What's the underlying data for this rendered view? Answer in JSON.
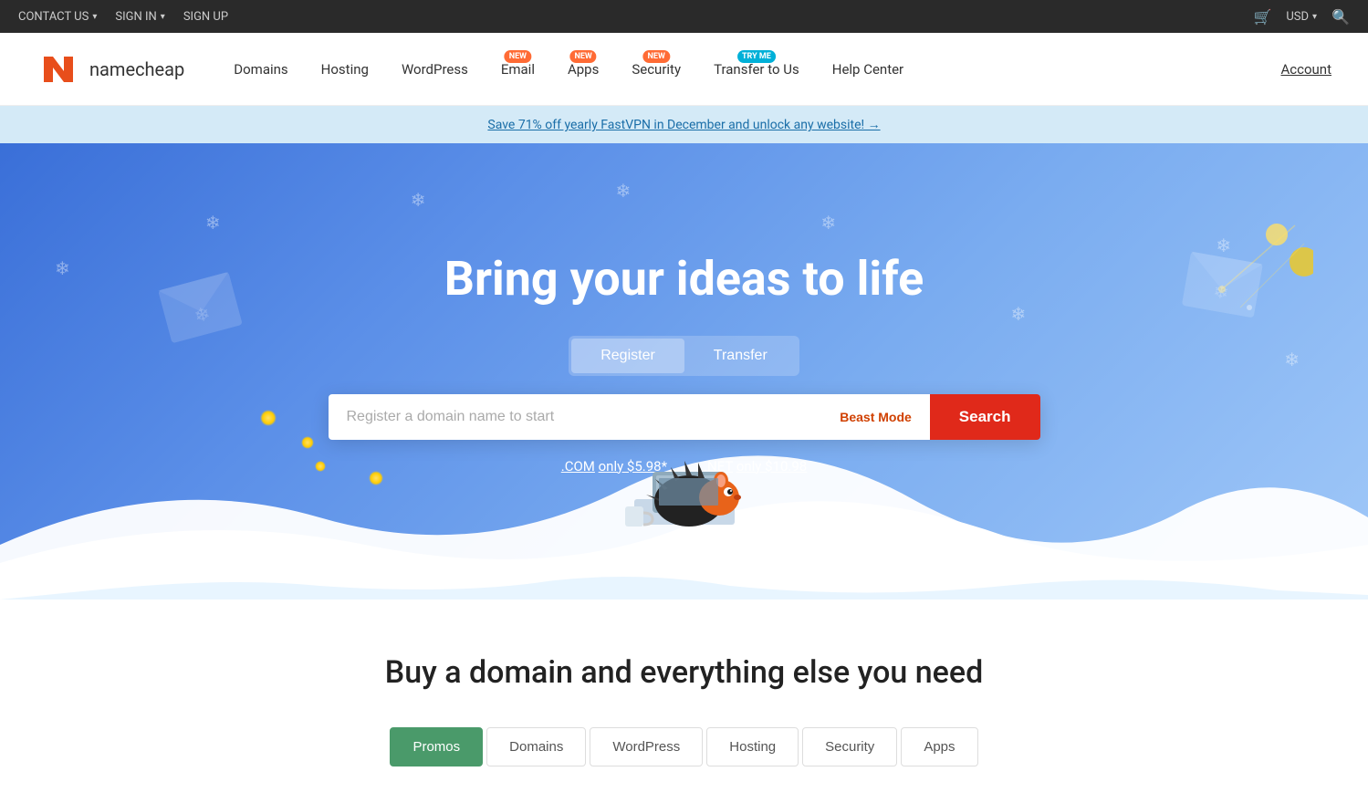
{
  "topbar": {
    "contact_us": "CONTACT US",
    "sign_in": "SIGN IN",
    "sign_up": "SIGN UP",
    "currency": "USD"
  },
  "nav": {
    "logo_text": "namecheap",
    "items": [
      {
        "id": "domains",
        "label": "Domains",
        "badge": null
      },
      {
        "id": "hosting",
        "label": "Hosting",
        "badge": null
      },
      {
        "id": "wordpress",
        "label": "WordPress",
        "badge": null
      },
      {
        "id": "email",
        "label": "Email",
        "badge": "NEW"
      },
      {
        "id": "apps",
        "label": "Apps",
        "badge": "NEW"
      },
      {
        "id": "security",
        "label": "Security",
        "badge": "NEW"
      },
      {
        "id": "transfer",
        "label": "Transfer to Us",
        "badge": "TRY ME"
      },
      {
        "id": "help",
        "label": "Help Center",
        "badge": null
      }
    ],
    "account": "Account"
  },
  "promo": {
    "text": "Save 71% off yearly FastVPN in December and unlock any website! →"
  },
  "hero": {
    "title": "Bring your ideas to life",
    "tab_register": "Register",
    "tab_transfer": "Transfer",
    "search_placeholder": "Register a domain name to start",
    "beast_mode": "Beast Mode",
    "search_btn": "Search",
    "com_price": ".COM only $5.98*",
    "net_price": ".NET only $10.98"
  },
  "bottom": {
    "title": "Buy a domain and everything else you need",
    "tabs": [
      {
        "id": "promos",
        "label": "Promos",
        "active": true
      },
      {
        "id": "domains",
        "label": "Domains",
        "active": false
      },
      {
        "id": "wordpress",
        "label": "WordPress",
        "active": false
      },
      {
        "id": "hosting",
        "label": "Hosting",
        "active": false
      },
      {
        "id": "security",
        "label": "Security",
        "active": false
      },
      {
        "id": "apps",
        "label": "Apps",
        "active": false
      }
    ]
  },
  "colors": {
    "accent_orange": "#e84e1b",
    "accent_green": "#4a9a6a",
    "hero_blue_dark": "#3a6fd8",
    "hero_blue_light": "#a0c8f8"
  }
}
